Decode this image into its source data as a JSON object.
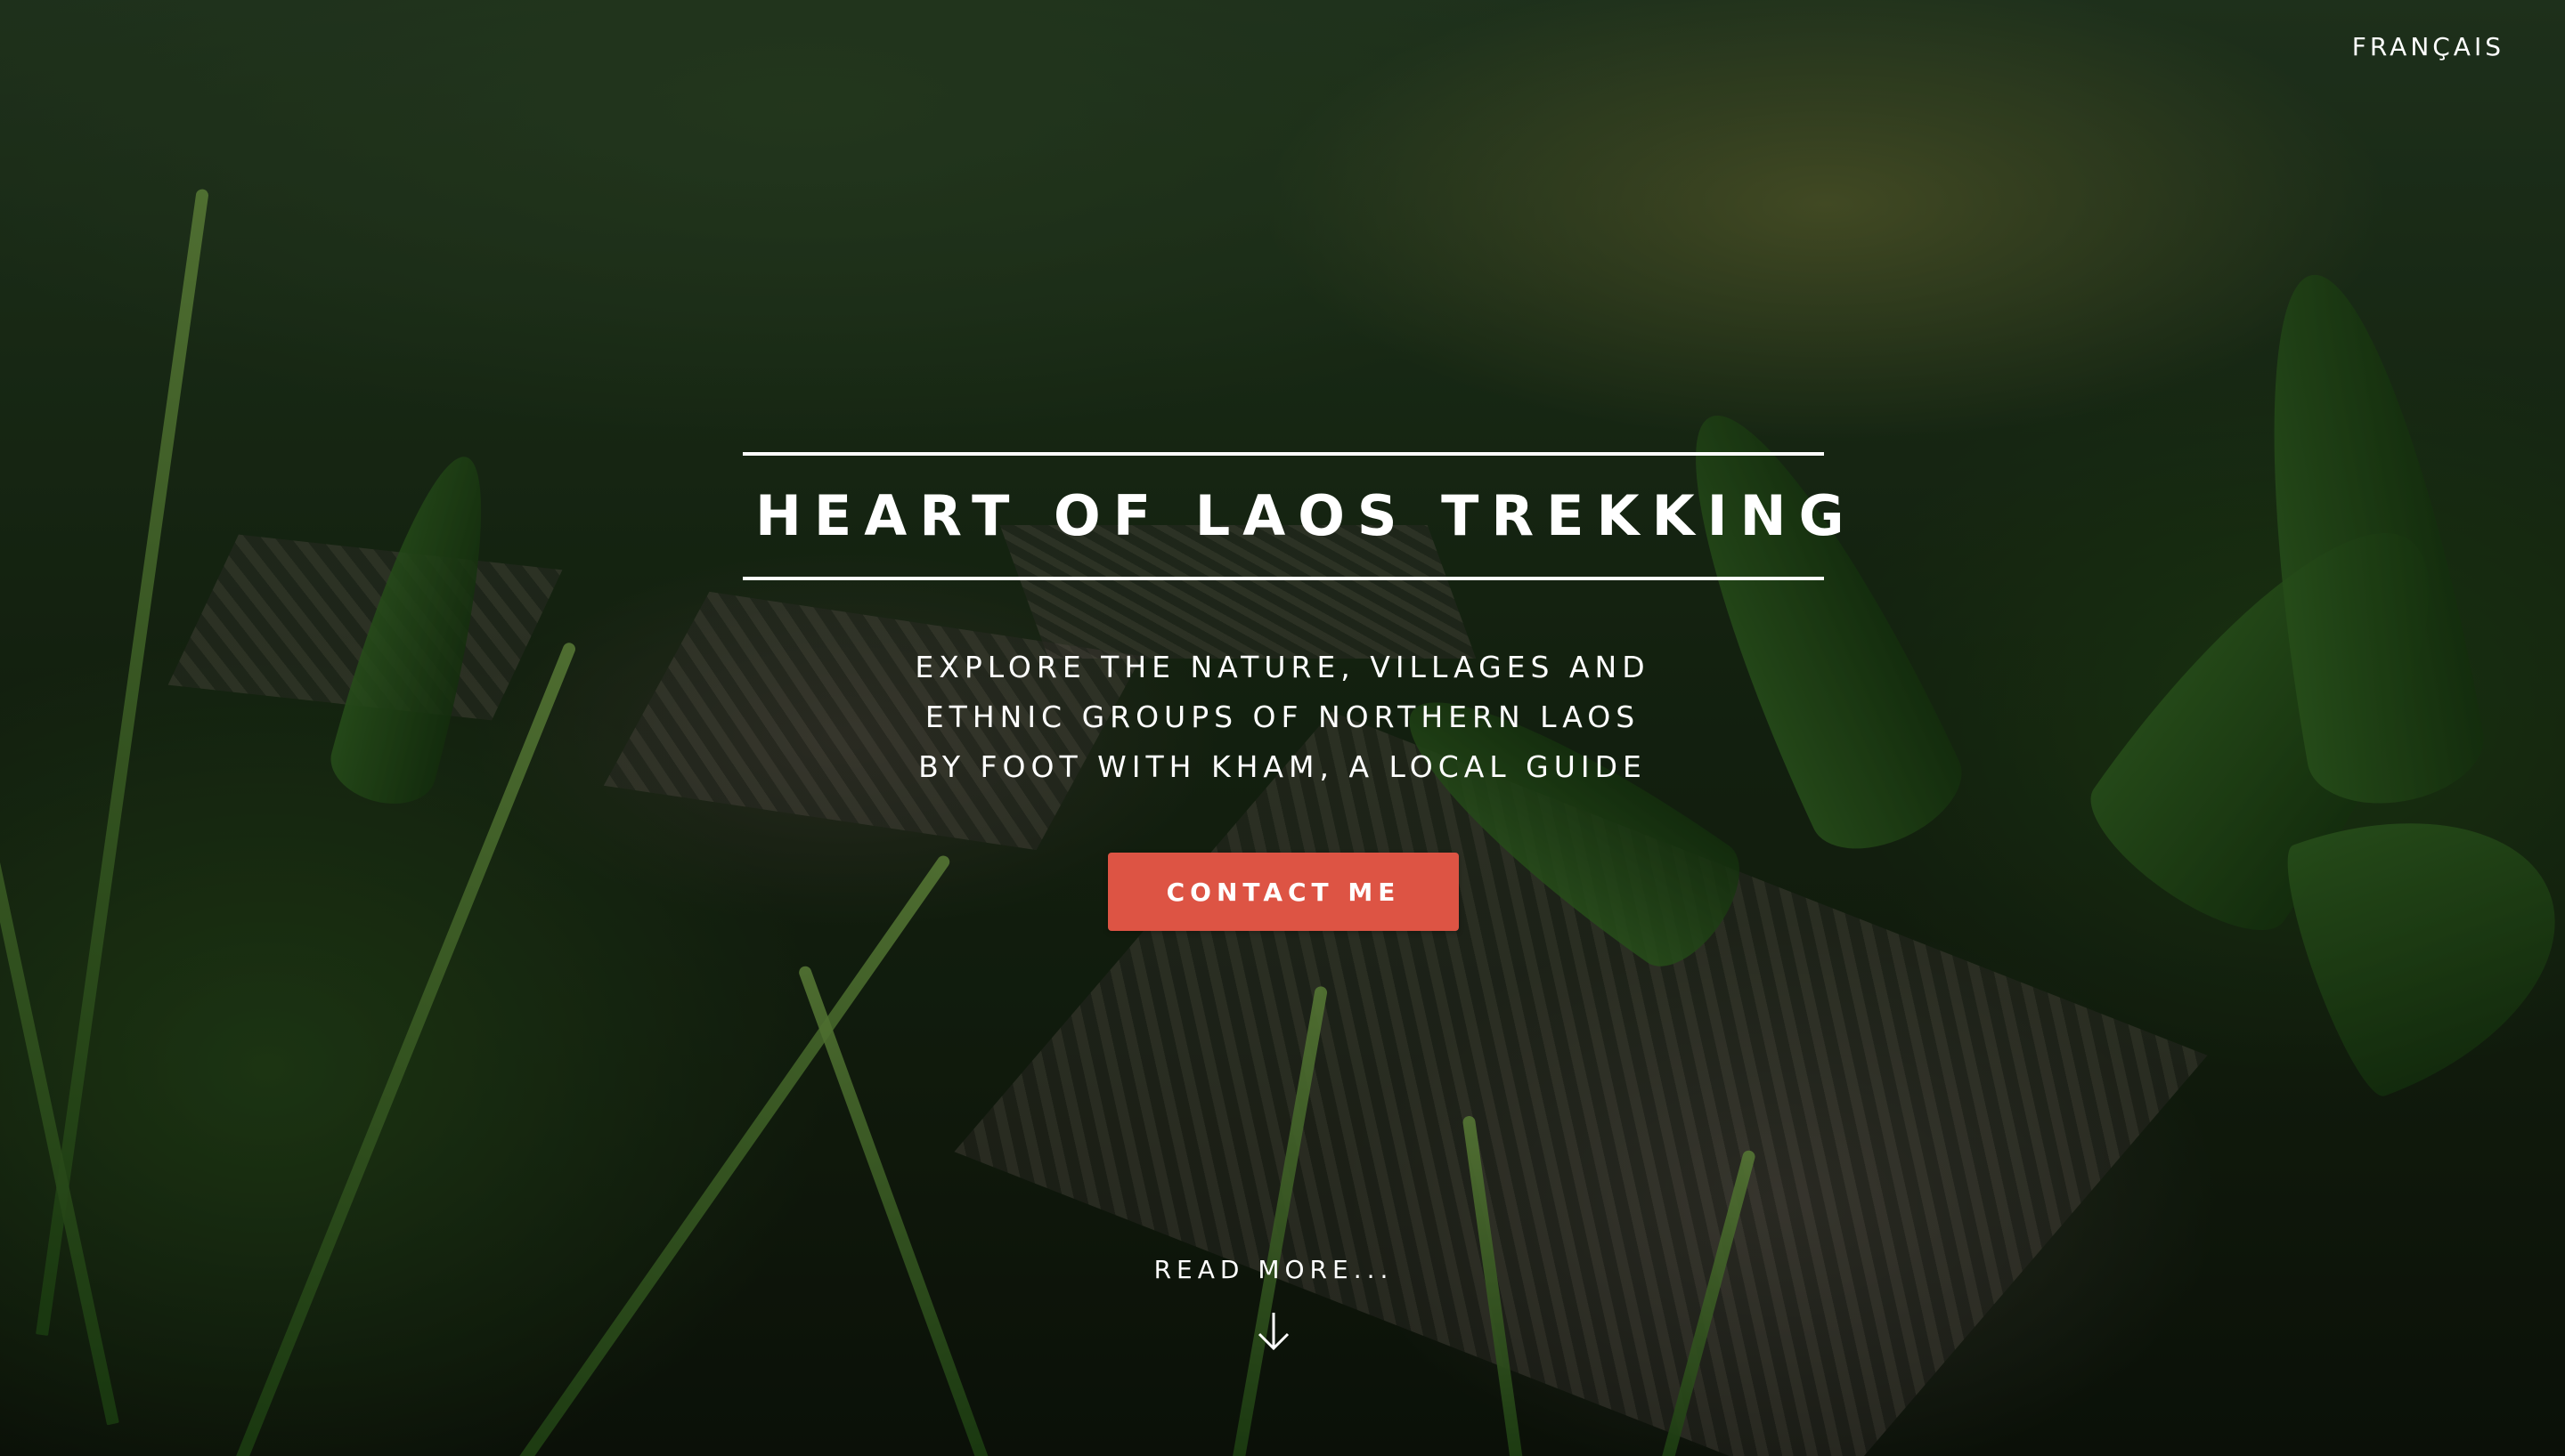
{
  "nav": {
    "language_link": "FRANÇAIS"
  },
  "hero": {
    "title": "HEART OF LAOS TREKKING",
    "subtitle_lines": [
      "EXPLORE THE NATURE, VILLAGES AND",
      "ETHNIC GROUPS OF NORTHERN LAOS",
      "BY FOOT WITH KHAM, A LOCAL GUIDE"
    ],
    "cta_label": "CONTACT ME",
    "read_more_label": "READ MORE...",
    "read_more_icon": "arrow-down-icon"
  },
  "colors": {
    "accent": "#dd5444",
    "text": "#ffffff"
  }
}
